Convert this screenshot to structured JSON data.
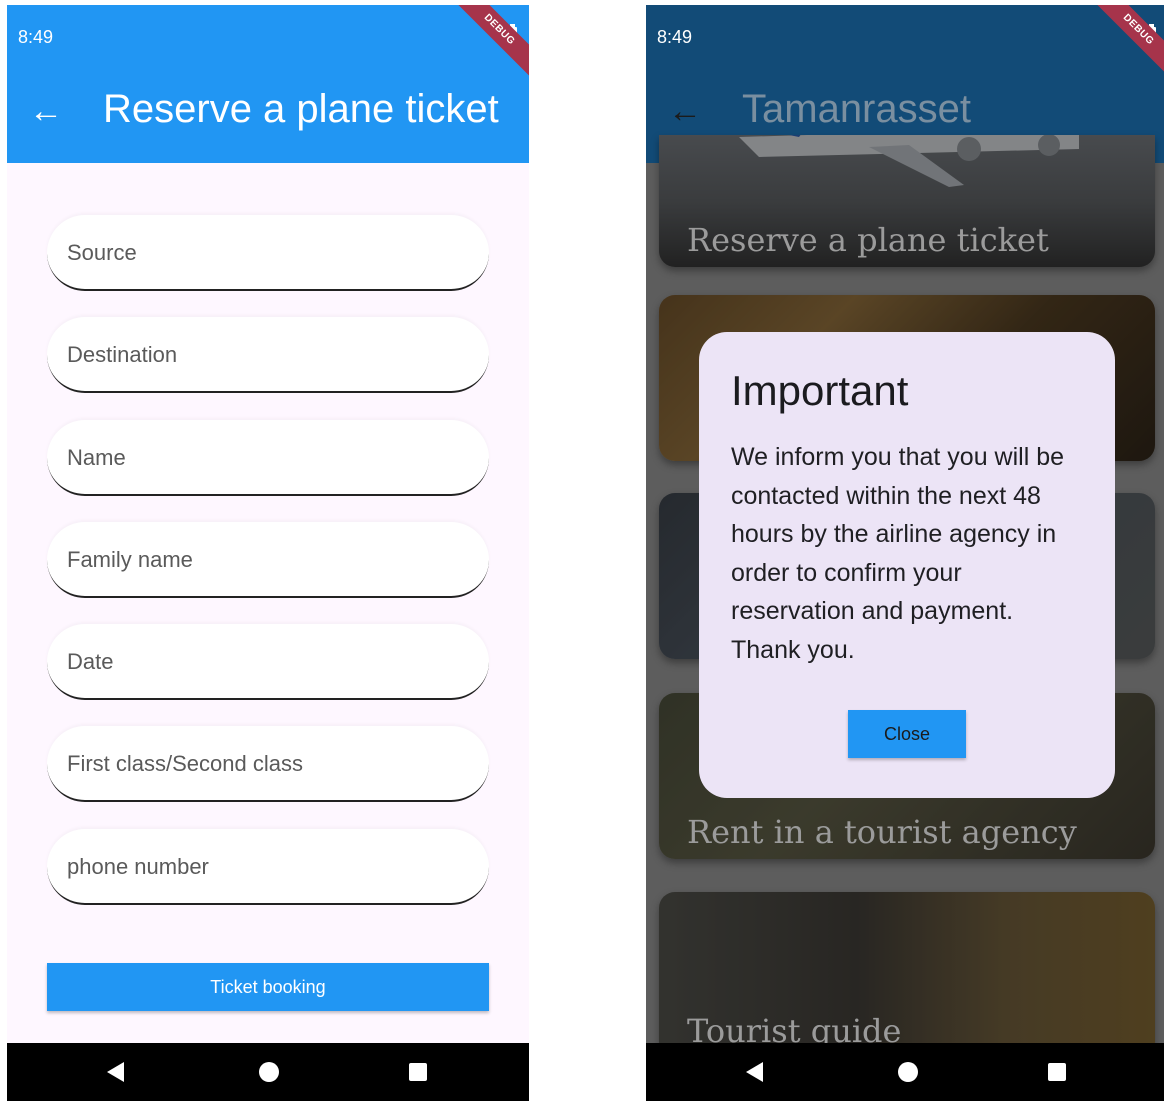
{
  "left_screen": {
    "status_time": "8:49",
    "debug_ribbon": "DEBUG",
    "app_bar_title": "Reserve a plane ticket",
    "fields": [
      {
        "placeholder": "Source",
        "value": ""
      },
      {
        "placeholder": "Destination",
        "value": ""
      },
      {
        "placeholder": "Name",
        "value": ""
      },
      {
        "placeholder": "Family name",
        "value": ""
      },
      {
        "placeholder": "Date",
        "value": ""
      },
      {
        "placeholder": "First class/Second class",
        "value": ""
      },
      {
        "placeholder": "phone number",
        "value": ""
      }
    ],
    "submit_label": "Ticket booking"
  },
  "right_screen": {
    "status_time": "8:49",
    "debug_ribbon": "DEBUG",
    "app_bar_title": "Tamanrasset",
    "cards": [
      {
        "label": "Reserve a plane ticket"
      },
      {
        "label": ""
      },
      {
        "label": ""
      },
      {
        "label": "Rent in a tourist agency"
      },
      {
        "label": "Tourist guide"
      }
    ],
    "dialog": {
      "title": "Important",
      "body": "We inform you that you will be contacted within the next 48 hours by the airline agency in order to confirm your reservation and payment. Thank you.",
      "close_label": "Close"
    }
  },
  "colors": {
    "primary": "#2196f3",
    "app_bar_dimmed": "#124b77",
    "dialog_bg": "#ece4f6",
    "page_bg": "#fef7ff"
  },
  "icons": {
    "back": "arrow-left-icon",
    "nav_back": "triangle-back-icon",
    "nav_home": "circle-home-icon",
    "nav_recent": "square-recents-icon"
  }
}
